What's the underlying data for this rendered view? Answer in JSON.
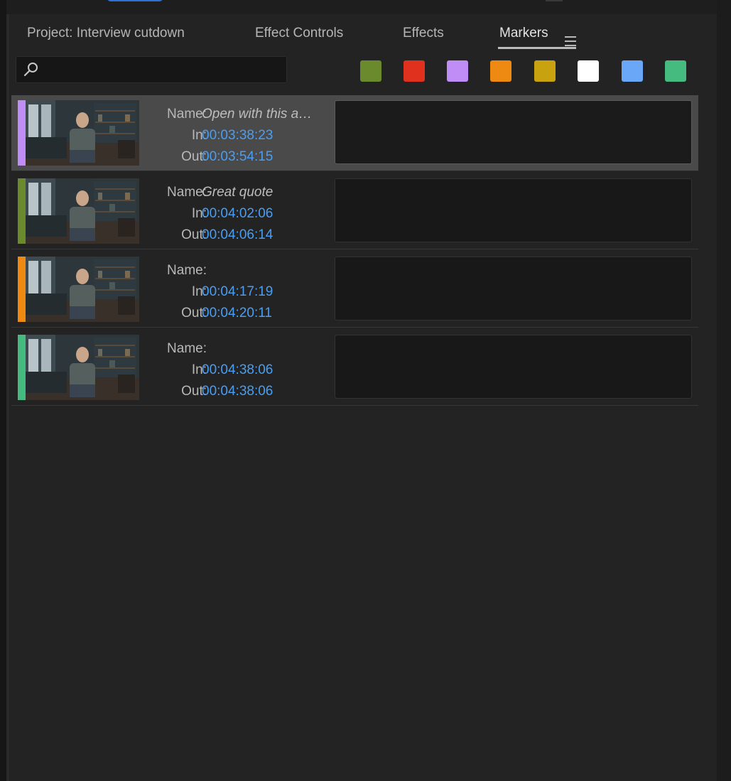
{
  "tabs": [
    {
      "label": "Project: Interview cutdown",
      "active": false
    },
    {
      "label": "Effect Controls",
      "active": false
    },
    {
      "label": "Effects",
      "active": false
    },
    {
      "label": "Markers",
      "active": true
    }
  ],
  "search": {
    "placeholder": "",
    "value": ""
  },
  "color_filters": [
    "#6b8a2e",
    "#e0311f",
    "#c08cf5",
    "#ee8a12",
    "#c9a30f",
    "#ffffff",
    "#6aa7f7",
    "#46bb7f"
  ],
  "field_labels": {
    "name": "Name:",
    "in": "In:",
    "out": "Out:"
  },
  "markers": [
    {
      "color": "#c08cf5",
      "name": "Open with this a…",
      "in": "00:03:38:23",
      "out": "00:03:54:15",
      "selected": true,
      "comment": ""
    },
    {
      "color": "#6b8a2e",
      "name": "Great quote",
      "in": "00:04:02:06",
      "out": "00:04:06:14",
      "selected": false,
      "comment": ""
    },
    {
      "color": "#ee8a12",
      "name": "",
      "in": "00:04:17:19",
      "out": "00:04:20:11",
      "selected": false,
      "comment": ""
    },
    {
      "color": "#46bb7f",
      "name": "",
      "in": "00:04:38:06",
      "out": "00:04:38:06",
      "selected": false,
      "comment": ""
    }
  ]
}
